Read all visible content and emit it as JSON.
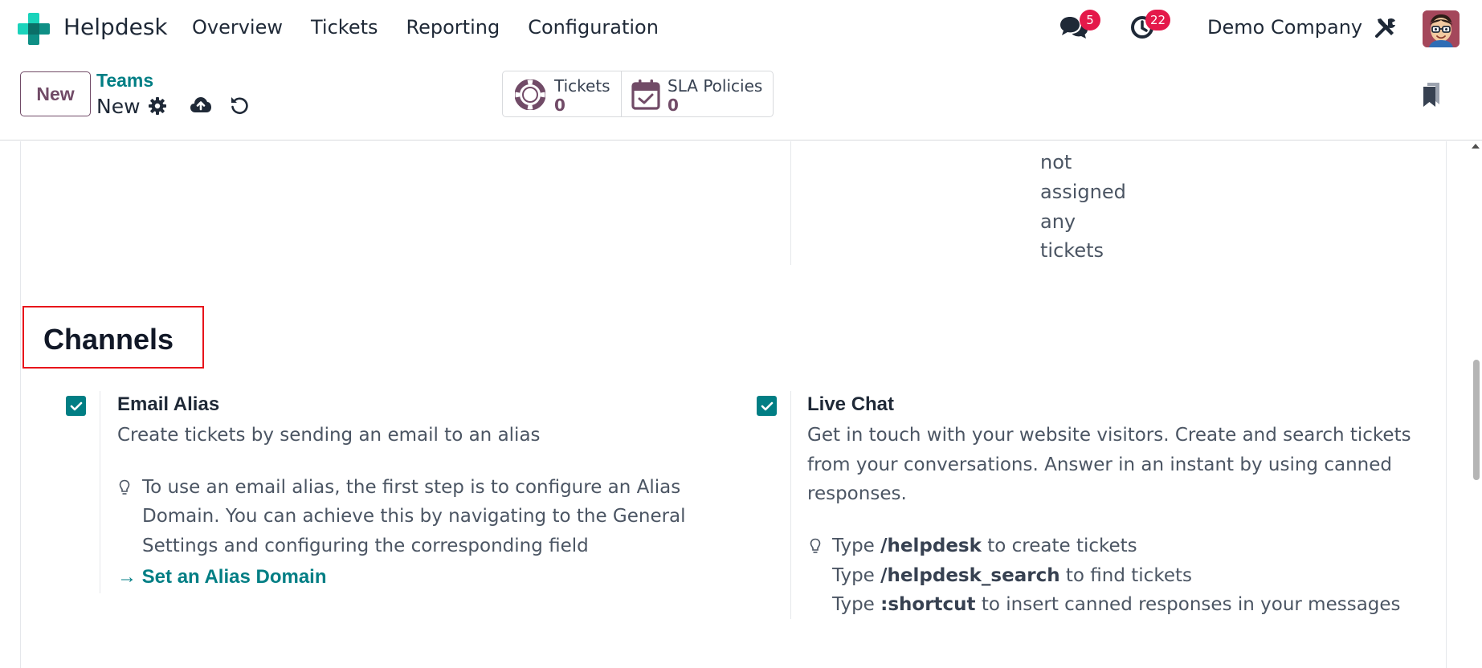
{
  "app": {
    "name": "Helpdesk",
    "menu": [
      "Overview",
      "Tickets",
      "Reporting",
      "Configuration"
    ],
    "company": "Demo Company",
    "messages_count": "5",
    "activities_count": "22"
  },
  "control_panel": {
    "new_label": "New",
    "breadcrumb_parent": "Teams",
    "breadcrumb_current": "New",
    "stats": [
      {
        "label": "Tickets",
        "value": "0",
        "icon": "lifebuoy-icon"
      },
      {
        "label": "SLA Policies",
        "value": "0",
        "icon": "calendar-check-icon"
      }
    ]
  },
  "content": {
    "truncated_text": [
      "not",
      "assigned",
      "any",
      "tickets"
    ],
    "section_title": "Channels",
    "options": {
      "email": {
        "checked": true,
        "title": "Email Alias",
        "description": "Create tickets by sending an email to an alias",
        "hint_lines": [
          "To use an email alias, the first step is to configure an Alias",
          "Domain. You can achieve this by navigating to the General",
          "Settings and configuring the corresponding field"
        ],
        "link": "Set an Alias Domain"
      },
      "livechat": {
        "checked": true,
        "title": "Live Chat",
        "description_lines": [
          "Get in touch with your website visitors. Create and search tickets",
          "from your conversations. Answer in an instant by using canned",
          "responses."
        ],
        "hints": [
          {
            "pre": "Type",
            "cmd": "/helpdesk",
            "post": "to create tickets"
          },
          {
            "pre": "Type",
            "cmd": "/helpdesk_search",
            "post": "to find tickets"
          },
          {
            "pre": "Type",
            "cmd": ":shortcut",
            "post": "to insert canned responses in your messages"
          }
        ]
      }
    }
  },
  "colors": {
    "primary": "#714b67",
    "teal": "#017e84",
    "badge": "#e4194a",
    "highlight": "#e8141b"
  }
}
